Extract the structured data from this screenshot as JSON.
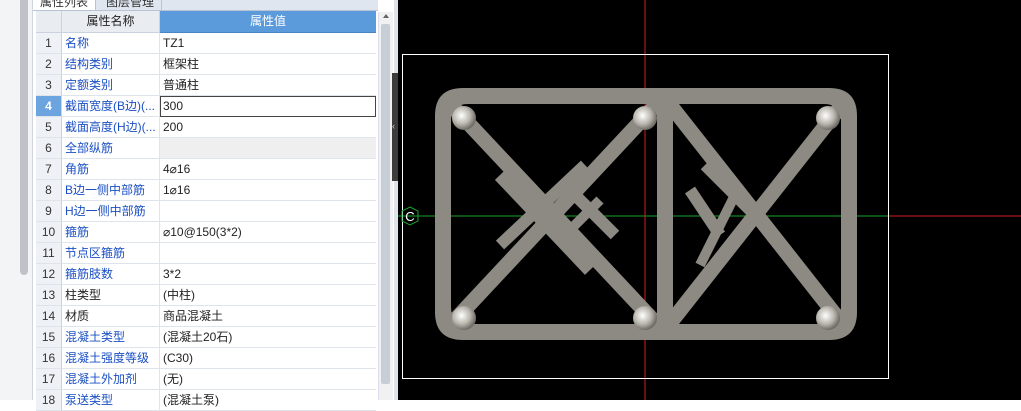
{
  "tabs": [
    "属性列表",
    "图层管理"
  ],
  "header": {
    "num": "",
    "name": "属性名称",
    "value": "属性值"
  },
  "rows": [
    {
      "num": "1",
      "name": "名称",
      "value": "TZ1",
      "link": true
    },
    {
      "num": "2",
      "name": "结构类别",
      "value": "框架柱",
      "link": true
    },
    {
      "num": "3",
      "name": "定额类别",
      "value": "普通柱",
      "link": true
    },
    {
      "num": "4",
      "name": "截面宽度(B边)(...",
      "value": "300",
      "link": true,
      "selected": true
    },
    {
      "num": "5",
      "name": "截面高度(H边)(...",
      "value": "200",
      "link": true
    },
    {
      "num": "6",
      "name": "全部纵筋",
      "value": "",
      "link": true,
      "group": true
    },
    {
      "num": "7",
      "name": "角筋",
      "value": "4⌀16",
      "link": true
    },
    {
      "num": "8",
      "name": "B边一侧中部筋",
      "value": "1⌀16",
      "link": true
    },
    {
      "num": "9",
      "name": "H边一侧中部筋",
      "value": "",
      "link": true
    },
    {
      "num": "10",
      "name": "箍筋",
      "value": "⌀10@150(3*2)",
      "link": true
    },
    {
      "num": "11",
      "name": "节点区箍筋",
      "value": "",
      "link": true
    },
    {
      "num": "12",
      "name": "箍筋肢数",
      "value": "3*2",
      "link": true
    },
    {
      "num": "13",
      "name": "柱类型",
      "value": "(中柱)",
      "link": false
    },
    {
      "num": "14",
      "name": "材质",
      "value": "商品混凝土",
      "link": false
    },
    {
      "num": "15",
      "name": "混凝土类型",
      "value": "(混凝土20石)",
      "link": true
    },
    {
      "num": "16",
      "name": "混凝土强度等级",
      "value": "(C30)",
      "link": true
    },
    {
      "num": "17",
      "name": "混凝土外加剂",
      "value": "(无)",
      "link": true
    },
    {
      "num": "18",
      "name": "泵送类型",
      "value": "(混凝土泵)",
      "link": true
    }
  ],
  "canvas": {
    "axis_label": "C"
  },
  "colors": {
    "link": "#1a4fc4",
    "header_accent": "#5b9bdc",
    "rebar": "#8c8a82",
    "axis_red": "#d21e1e",
    "axis_green": "#1aa52a"
  }
}
